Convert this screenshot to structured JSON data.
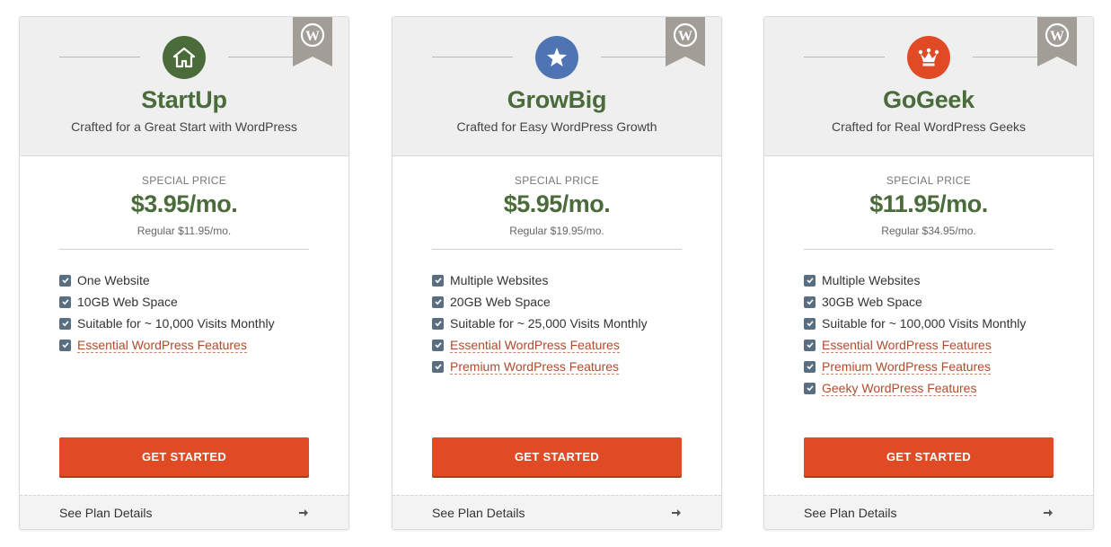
{
  "colors": {
    "brand_green": "#4a6b3a",
    "cta_orange": "#e04b25",
    "star_blue": "#4f74b3",
    "crown_red": "#e04b25",
    "checkbox": "#5a6e82",
    "ribbon": "#a29e97"
  },
  "plans": [
    {
      "icon": "house-icon",
      "name": "StartUp",
      "tagline": "Crafted for a Great Start with WordPress",
      "special_label": "SPECIAL PRICE",
      "price": "$3.95/mo.",
      "regular": "Regular $11.95/mo.",
      "features": [
        "One Website",
        "10GB Web Space",
        "Suitable for ~ 10,000 Visits Monthly",
        "Essential WordPress Features"
      ],
      "cta": "GET STARTED",
      "details": "See Plan Details"
    },
    {
      "icon": "star-icon",
      "name": "GrowBig",
      "tagline": "Crafted for Easy WordPress Growth",
      "special_label": "SPECIAL PRICE",
      "price": "$5.95/mo.",
      "regular": "Regular $19.95/mo.",
      "features": [
        "Multiple Websites",
        "20GB Web Space",
        "Suitable for ~ 25,000 Visits Monthly",
        "Essential WordPress Features",
        "Premium WordPress Features"
      ],
      "cta": "GET STARTED",
      "details": "See Plan Details"
    },
    {
      "icon": "crown-icon",
      "name": "GoGeek",
      "tagline": "Crafted for Real WordPress Geeks",
      "special_label": "SPECIAL PRICE",
      "price": "$11.95/mo.",
      "regular": "Regular $34.95/mo.",
      "features": [
        "Multiple Websites",
        "30GB Web Space",
        "Suitable for ~ 100,000 Visits Monthly",
        "Essential WordPress Features",
        "Premium WordPress Features",
        "Geeky WordPress Features"
      ],
      "cta": "GET STARTED",
      "details": "See Plan Details"
    }
  ]
}
